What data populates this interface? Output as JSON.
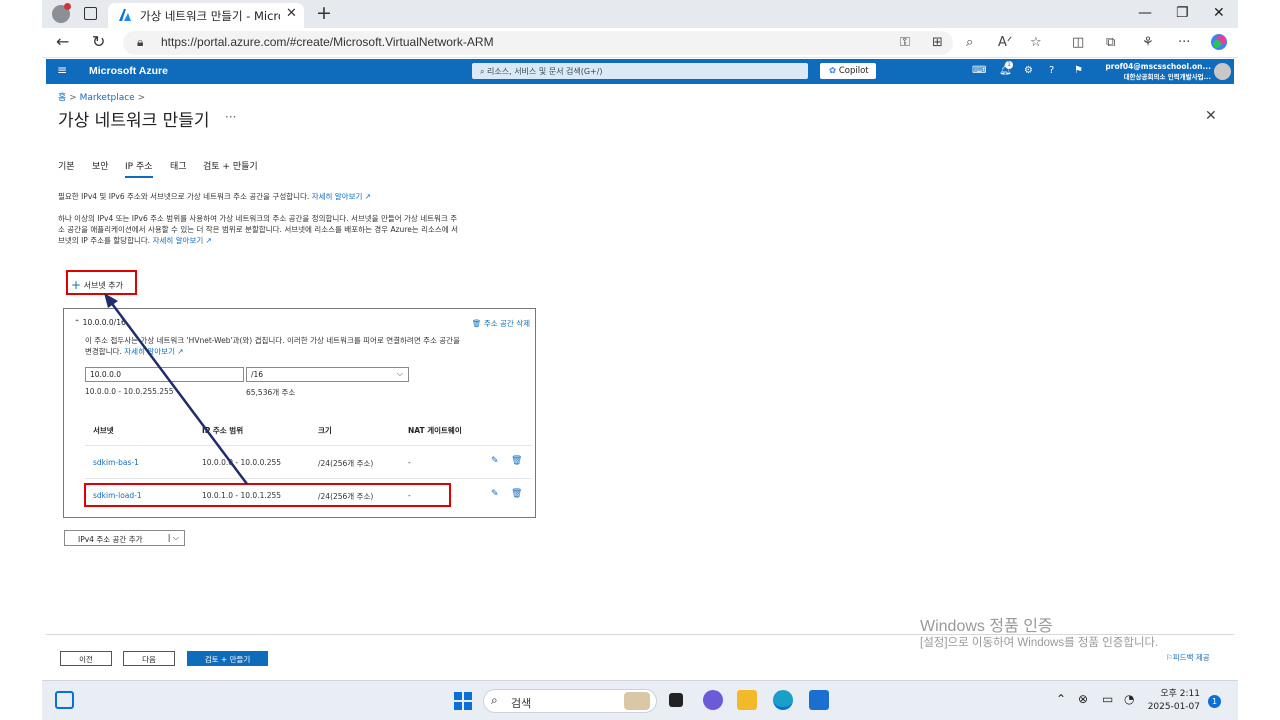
{
  "browser": {
    "tab_title": "가상 네트워크 만들기 - Microsoft",
    "url": "https://portal.azure.com/#create/Microsoft.VirtualNetwork-ARM"
  },
  "azure": {
    "brand": "Microsoft Azure",
    "search_placeholder": "리소스, 서비스 및 문서 검색(G+/)",
    "copilot_label": "Copilot",
    "notification_count": "1",
    "account_email": "prof04@mscsschool.on...",
    "account_org": "대한상공회의소 인력개발사업..."
  },
  "breadcrumb": {
    "home": "홈",
    "marketplace": "Marketplace"
  },
  "page": {
    "title": "가상 네트워크 만들기",
    "more": "···"
  },
  "tabs": [
    {
      "label": "기본"
    },
    {
      "label": "보안"
    },
    {
      "label": "IP 주소"
    },
    {
      "label": "태그"
    },
    {
      "label": "검토 + 만들기"
    }
  ],
  "intro": {
    "line1": "필요한 IPv4 및 IPv6 주소와 서브넷으로 가상 네트워크 주소 공간을 구성합니다.",
    "learn_more": "자세히 알아보기",
    "p2_line1": "하나 이상의 IPv4 또는 IPv6 주소 범위를 사용하여 가상 네트워크의 주소 공간을 정의합니다. 서브넷을 만들어 가상 네트워크 주",
    "p2_line2": "소 공간을 애플리케이션에서 사용할 수 있는 더 작은 범위로 분할합니다. 서브넷에 리소스를 배포하는 경우 Azure는 리소스에 서",
    "p2_line3": "브넷의 IP 주소를 할당합니다."
  },
  "add_subnet": "서브넷 추가",
  "address_space": {
    "header": "10.0.0.0/16",
    "delete_label": "주소 공간 삭제",
    "warning_line1": "이 주소 접두사는 가상 네트워크 'HVnet-Web'과(와) 겹칩니다. 이러한 가상 네트워크를 피어로 연결하려면 주소 공간을",
    "warning_line2": "변경합니다.",
    "start_ip": "10.0.0.0",
    "prefix": "/16",
    "range": "10.0.0.0 - 10.0.255.255",
    "count": "65,536개 주소",
    "columns": [
      "서브넷",
      "IP 주소 범위",
      "크기",
      "NAT 게이트웨이"
    ],
    "rows": [
      {
        "name": "sdkim-bas-1",
        "range": "10.0.0.0 - 10.0.0.255",
        "size": "/24(256개 주소)",
        "nat": "-"
      },
      {
        "name": "sdkim-load-1",
        "range": "10.0.1.0 - 10.0.1.255",
        "size": "/24(256개 주소)",
        "nat": "-"
      }
    ]
  },
  "add_ipv4": "IPv4 주소 공간 추가",
  "footer": {
    "prev": "이전",
    "next": "다음",
    "review": "검토 + 만들기",
    "feedback": "피드백 제공"
  },
  "watermark": {
    "line1": "Windows 정품 인증",
    "line2": "[설정]으로 이동하여 Windows를 정품 인증합니다."
  },
  "taskbar": {
    "search": "검색",
    "time": "오후 2:11",
    "date": "2025-01-07",
    "badge": "1"
  },
  "colors": {
    "azure_blue": "#0f6cbd",
    "highlight_red": "#e00000",
    "arrow_navy": "#1f2d6b"
  }
}
